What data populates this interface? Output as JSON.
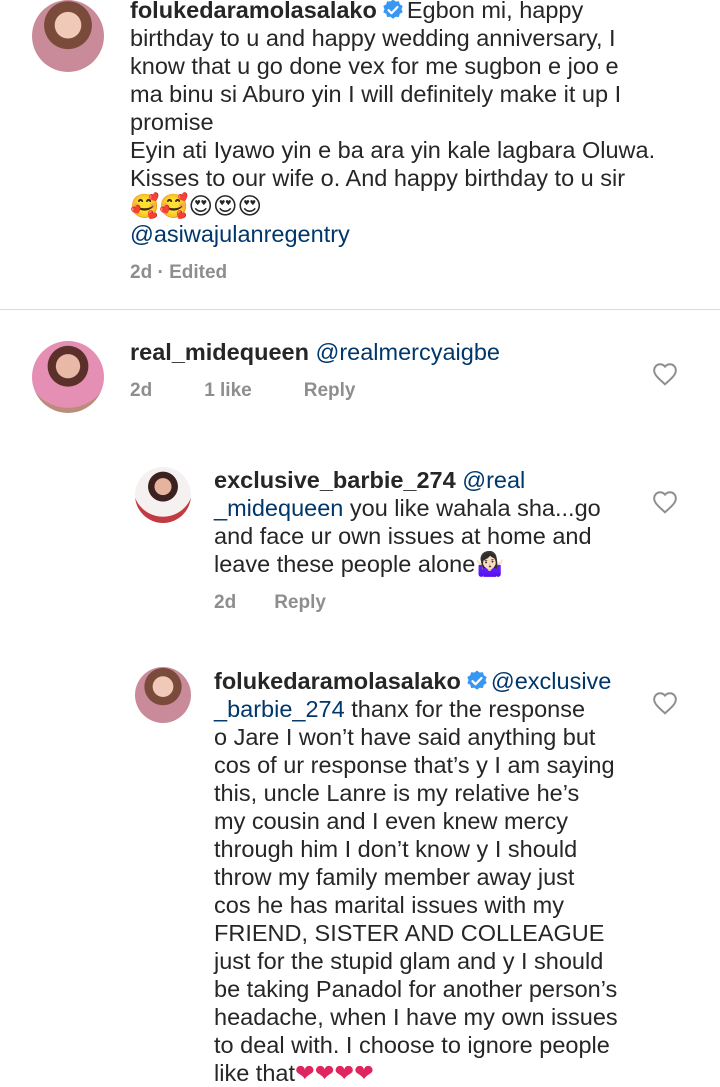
{
  "comments": [
    {
      "username": "folukedaramolasalako",
      "verified": true,
      "text_lines": [
        "Egbon mi, happy",
        "birthday to u and happy wedding anniversary, I",
        "know that u go done vex for me sugbon e joo e",
        "ma binu si Aburo yin I will definitely make it up I",
        "promise",
        "Eyin ati Iyawo yin e ba ara yin kale lagbara Oluwa.",
        "Kisses to our wife o. And happy birthday to u sir"
      ],
      "emojis": "🥰🥰😍😍😍",
      "mention_line": "@asiwajulanregentry",
      "time": "2d",
      "edited": "Edited"
    },
    {
      "username": "real_midequeen",
      "mention": "@realmercyaigbe",
      "time": "2d",
      "likes": "1 like",
      "reply": "Reply"
    },
    {
      "username": "exclusive_barbie_274",
      "mention_part1": "@real",
      "mention_part2": "_midequeen",
      "text_line1_rest": " you like wahala sha...go",
      "text_line2": "and face ur own issues at home and",
      "text_line3": "leave these people alone",
      "emoji": "🤷🏻‍♀️",
      "time": "2d",
      "reply": "Reply"
    },
    {
      "username": "folukedaramolasalako",
      "verified": true,
      "mention_part1": "@exclusive",
      "mention_part2": "_barbie_274",
      "line2_rest": " thanx for the response",
      "lines": [
        "o Jare I won’t have said anything but",
        "cos of ur response that’s y I am saying",
        "this, uncle Lanre is my relative he’s",
        "my cousin and I even knew mercy",
        "through him I don’t know y I should",
        "throw my family member away just",
        "cos he has marital issues with my",
        "FRIEND, SISTER AND COLLEAGUE",
        "just for the stupid glam and y I should",
        "be taking Panadol for another person’s",
        "headache, when I have my own issues",
        "to deal with. I choose to ignore people"
      ],
      "last_line": "like that",
      "hearts": "❤❤❤❤"
    }
  ],
  "colors": {
    "text": "#262626",
    "mention": "#00376b",
    "meta": "#8e8e8e",
    "verified": "#3897f0",
    "divider": "#dbdbdb"
  },
  "icons": [
    "verified-badge-icon",
    "heart-outline-icon"
  ]
}
